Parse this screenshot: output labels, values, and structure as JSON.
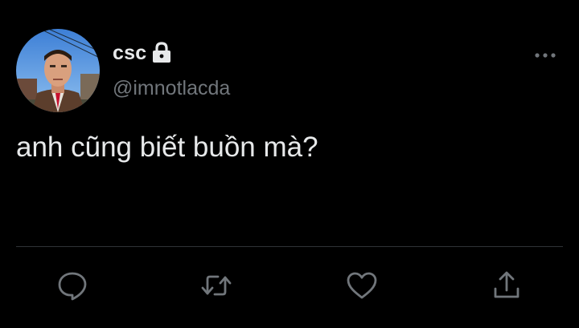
{
  "tweet": {
    "display_name": "csc",
    "protected_icon": "lock-icon",
    "handle": "@imnotlacda",
    "text": "anh cũng biết buồn mà?"
  },
  "actions": [
    {
      "name": "reply",
      "icon": "reply-icon"
    },
    {
      "name": "retweet",
      "icon": "retweet-icon"
    },
    {
      "name": "like",
      "icon": "heart-icon"
    },
    {
      "name": "share",
      "icon": "share-icon"
    }
  ],
  "colors": {
    "background": "#000000",
    "primary_text": "#e7e9ea",
    "secondary_text": "#71767b",
    "divider": "#2f3336"
  }
}
